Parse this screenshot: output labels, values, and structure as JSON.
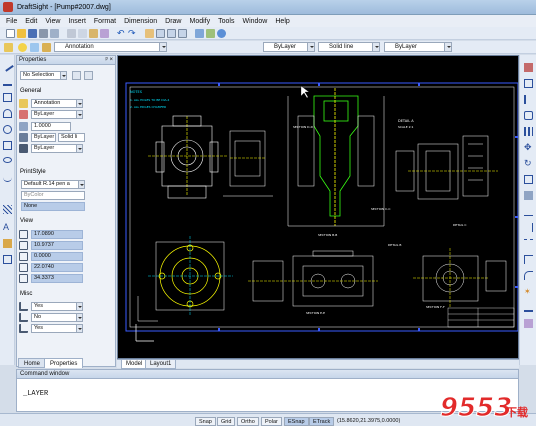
{
  "window": {
    "title": "DraftSight - [Pump#2007.dwg]"
  },
  "menu": [
    "File",
    "Edit",
    "View",
    "Insert",
    "Format",
    "Dimension",
    "Draw",
    "Modify",
    "Tools",
    "Window",
    "Help"
  ],
  "toolbar2": {
    "layer_value": "Annotation",
    "color_value": "ByLayer",
    "linestyle_value": "Solid line",
    "lineweight_value": "ByLayer"
  },
  "properties_panel": {
    "title": "Properties",
    "selection_value": "No Selection",
    "sections": {
      "general": "General",
      "printstyle": "PrintStyle",
      "view": "View",
      "misc": "Misc"
    },
    "general_rows": [
      "Annotation",
      "ByLayer",
      "1.0000",
      "ByLayer",
      "Solid li",
      "ByLayer"
    ],
    "printstyle_rows": [
      "Default R.14 pen a",
      "ByColor",
      "None"
    ],
    "view_rows": [
      "17.0890",
      "10.9737",
      "0.0000",
      "22.0740",
      "34.3373"
    ],
    "misc_rows": [
      "Yes",
      "No",
      "Yes"
    ],
    "tabs": [
      "Home",
      "Properties"
    ]
  },
  "sheet_tabs": [
    "Model",
    "Layout1"
  ],
  "command_window": {
    "title": "Command window",
    "text": "_LAYER"
  },
  "statusbar": {
    "buttons": [
      {
        "label": "Snap",
        "on": false
      },
      {
        "label": "Grid",
        "on": false
      },
      {
        "label": "Ortho",
        "on": false
      },
      {
        "label": "Polar",
        "on": false
      },
      {
        "label": "ESnap",
        "on": true
      },
      {
        "label": "ETrack",
        "on": true
      }
    ],
    "coordinates": "(15.8620,21.3975,0.0000)"
  },
  "watermark": {
    "text": "9553",
    "subtext": "下载"
  },
  "colors": {
    "cad_background": "#000000",
    "cad_line": "#ffffff",
    "cad_highlight": "#ffff00",
    "cad_green": "#39ff14",
    "cad_blue": "#3a5bff",
    "cad_cyan": "#00e5ff",
    "watermark": "#e22a2a"
  },
  "drawing_labels": {
    "notes_title": "NOTES",
    "note1": "1. ALL HOLES TO BE DIA.4",
    "note2": "2. ALL EDGES CHAMFER",
    "detail_a": "DETAIL A",
    "scale_a": "SCALE 2:1",
    "section_cc": "SECTION C-C",
    "section_dd": "SECTION D-D",
    "section_bb": "SECTION B-B",
    "detail_c": "DETAIL C",
    "detail_b": "DETAIL B",
    "section_ee": "SECTION E-E",
    "section_ff": "SECTION F-F"
  }
}
